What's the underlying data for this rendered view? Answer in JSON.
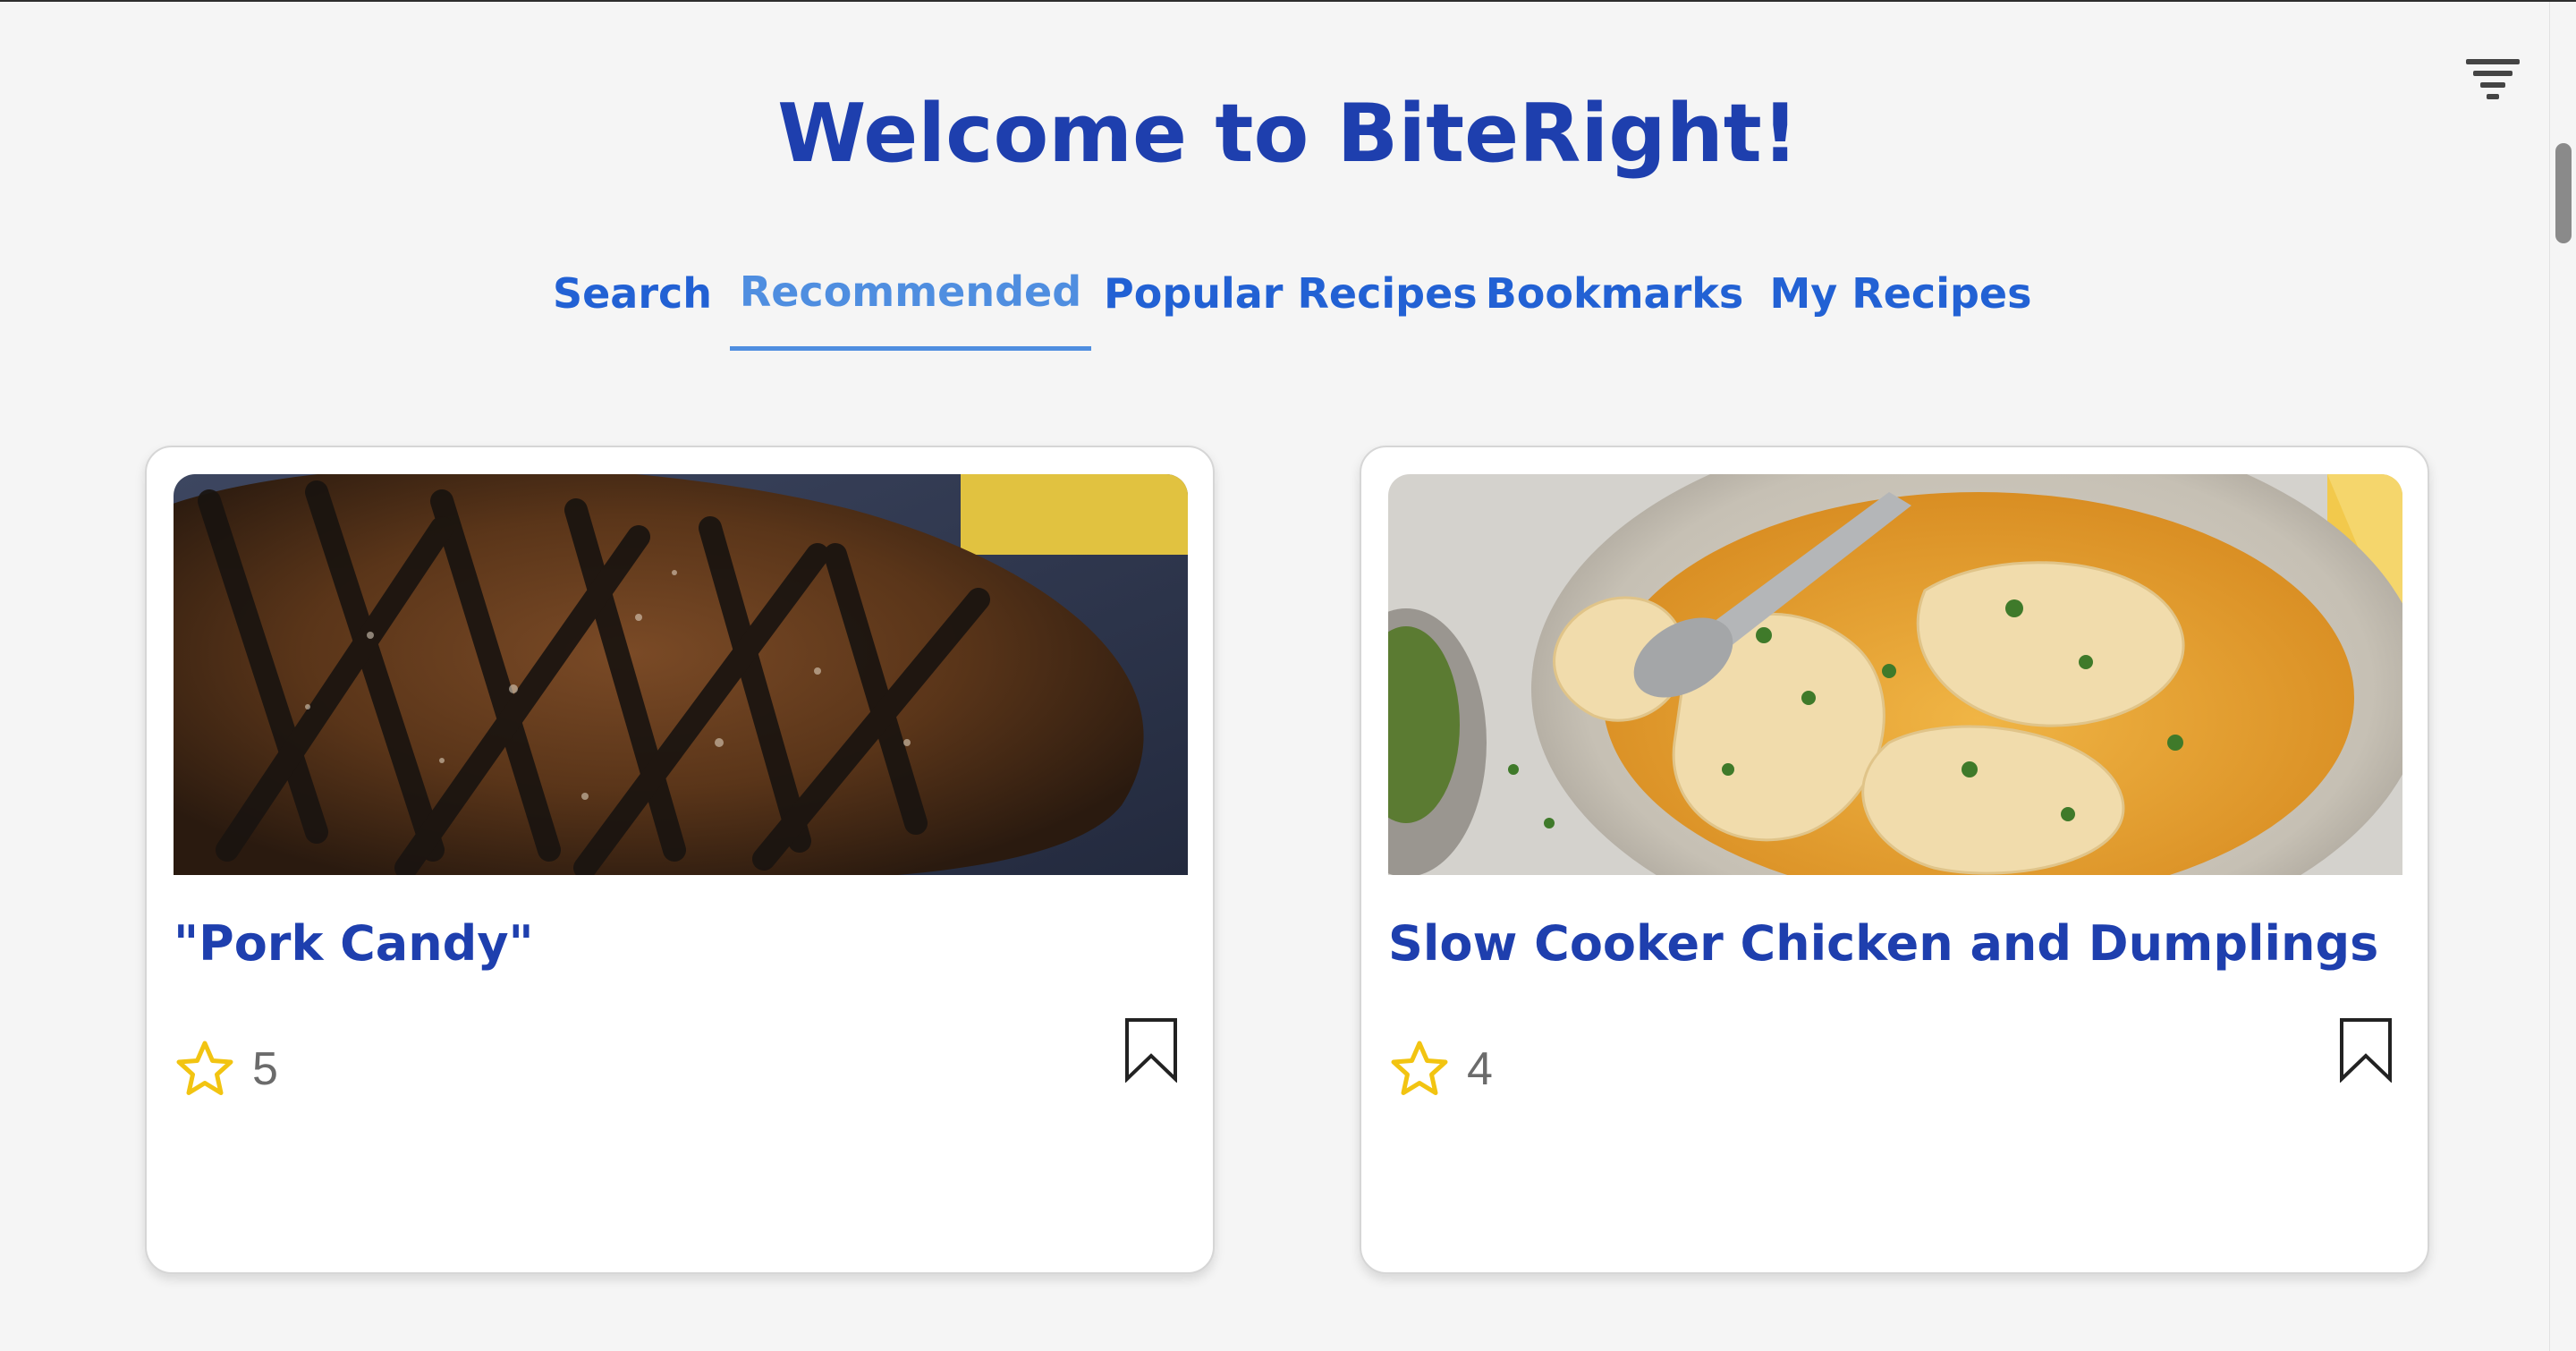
{
  "header": {
    "title": "Welcome to BiteRight!"
  },
  "tabs": [
    {
      "label": "Search",
      "active": false
    },
    {
      "label": "Recommended",
      "active": true
    },
    {
      "label": "Popular Recipes",
      "active": false
    },
    {
      "label": "Bookmarks",
      "active": false
    },
    {
      "label": "My Recipes",
      "active": false
    }
  ],
  "filter": {
    "icon": "filter-icon"
  },
  "recipes": [
    {
      "title": "\"Pork Candy\"",
      "rating": "5",
      "image": "grilled-pork-photo",
      "bookmark_icon": "bookmark-icon",
      "star_icon": "star-icon"
    },
    {
      "title": "Slow Cooker Chicken and Dumplings",
      "rating": "4",
      "image": "chicken-dumplings-photo",
      "bookmark_icon": "bookmark-icon",
      "star_icon": "star-icon"
    }
  ],
  "colors": {
    "title": "#1e3fae",
    "tab": "#2261d4",
    "tab_active": "#4f8ee0",
    "star": "#f2c411",
    "rating_text": "#6b6b6b",
    "background": "#f5f5f5"
  }
}
